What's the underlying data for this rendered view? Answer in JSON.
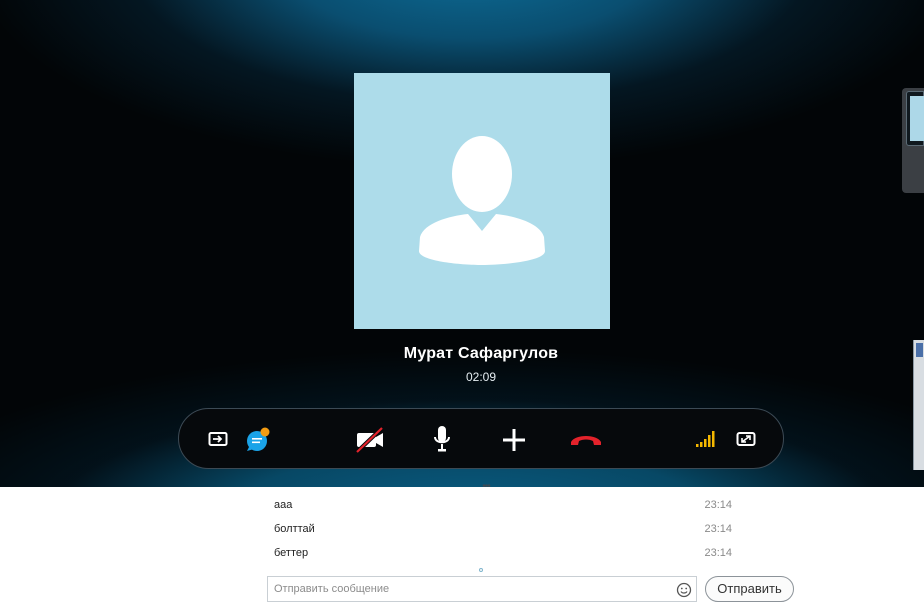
{
  "call": {
    "caller_name": "Мурат Сафаргулов",
    "duration": "02:09",
    "signal_strength_bars": 5,
    "chat_notification": true
  },
  "controls": [
    {
      "id": "share-screen",
      "icon": "share-screen-icon"
    },
    {
      "id": "chat",
      "icon": "chat-bubble-icon"
    },
    {
      "id": "video-toggle",
      "icon": "video-off-icon"
    },
    {
      "id": "microphone",
      "icon": "microphone-icon"
    },
    {
      "id": "add-participant",
      "icon": "plus-icon"
    },
    {
      "id": "hang-up",
      "icon": "end-call-icon"
    },
    {
      "id": "call-quality",
      "icon": "signal-icon"
    },
    {
      "id": "fullscreen",
      "icon": "expand-icon"
    }
  ],
  "chat": {
    "messages": [
      {
        "text": "ааа",
        "time": "23:14"
      },
      {
        "text": "болттай",
        "time": "23:14"
      },
      {
        "text": "беттер",
        "time": "23:14"
      }
    ],
    "input_placeholder": "Отправить сообщение",
    "input_value": "",
    "send_label": "Отправить"
  },
  "colors": {
    "avatar_bg": "#addcea",
    "hang_up": "#e3222b",
    "video_off_slash": "#e3222b",
    "signal": "#f5b800",
    "notification_badge": "#f39c12",
    "chat_icon": "#1aa3e8"
  }
}
